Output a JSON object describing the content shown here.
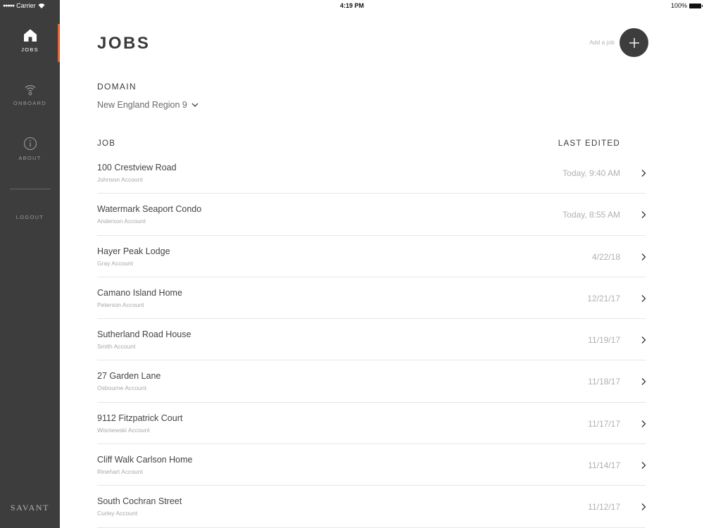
{
  "status_bar": {
    "carrier": "Carrier",
    "time": "4:19 PM",
    "battery": "100%"
  },
  "sidebar": {
    "items": [
      {
        "label": "JOBS",
        "icon": "home-icon"
      },
      {
        "label": "ONBOARD",
        "icon": "wifi-icon"
      },
      {
        "label": "ABOUT",
        "icon": "info-icon"
      }
    ],
    "logout": "LOGOUT",
    "brand": "SAVANT",
    "accent": "#e8642c"
  },
  "header": {
    "title": "JOBS",
    "add_label": "Add a job"
  },
  "domain": {
    "label": "DOMAIN",
    "value": "New England Region 9"
  },
  "table": {
    "col_job": "JOB",
    "col_edited": "LAST EDITED",
    "rows": [
      {
        "name": "100 Crestview Road",
        "account": "Johnson Account",
        "edited": "Today, 9:40 AM"
      },
      {
        "name": "Watermark Seaport Condo",
        "account": "Anderson Account",
        "edited": "Today, 8:55 AM"
      },
      {
        "name": "Hayer Peak Lodge",
        "account": "Gray Account",
        "edited": "4/22/18"
      },
      {
        "name": "Camano Island Home",
        "account": "Peterson Account",
        "edited": "12/21/17"
      },
      {
        "name": "Sutherland Road House",
        "account": "Smith Account",
        "edited": "11/19/17"
      },
      {
        "name": "27 Garden Lane",
        "account": "Osbourne Account",
        "edited": "11/18/17"
      },
      {
        "name": "9112 Fitzpatrick Court",
        "account": "Wisniewski Account",
        "edited": "11/17/17"
      },
      {
        "name": "Cliff Walk Carlson Home",
        "account": "Rinehart Account",
        "edited": "11/14/17"
      },
      {
        "name": "South Cochran Street",
        "account": "Curley Account",
        "edited": "11/12/17"
      }
    ]
  }
}
